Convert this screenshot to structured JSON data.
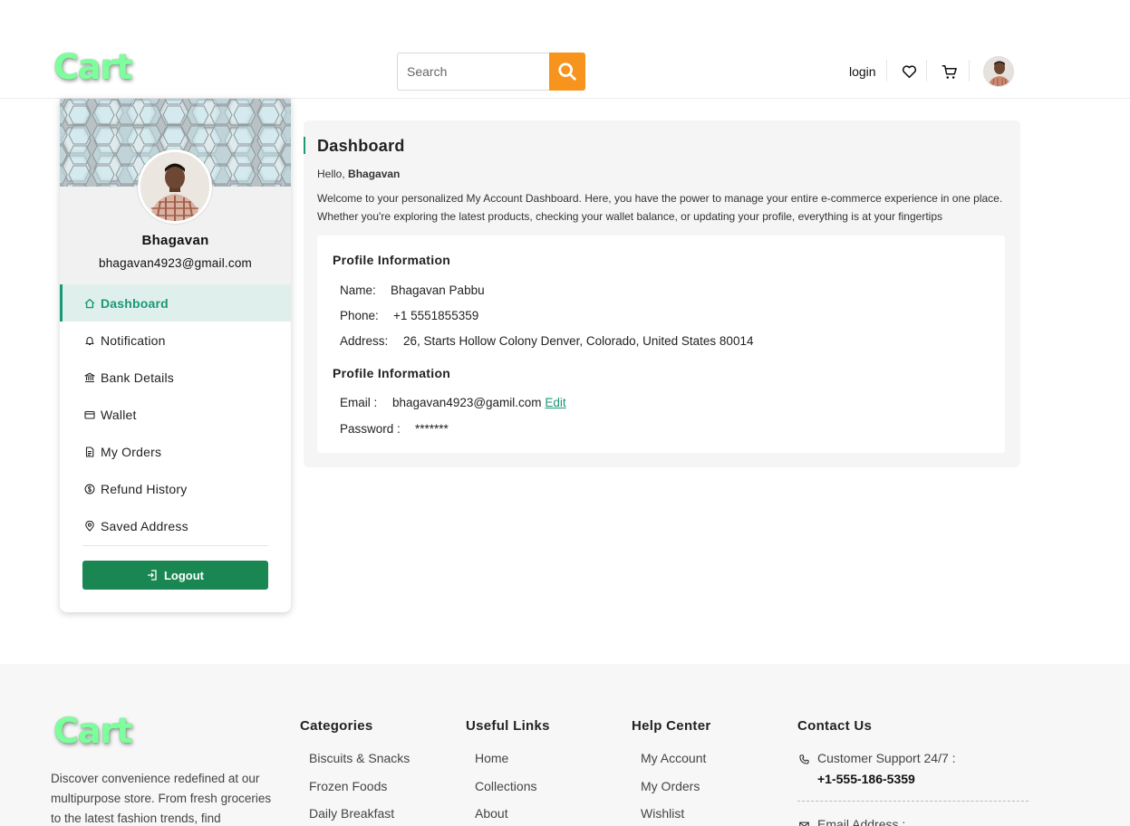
{
  "header": {
    "logo": "Cart",
    "search": {
      "placeholder": "Search",
      "value": ""
    },
    "login_label": "login",
    "icons": [
      "search-icon",
      "heart-icon",
      "cart-icon",
      "avatar"
    ]
  },
  "sidebar": {
    "name": "Bhagavan",
    "email": "bhagavan4923@gmail.com",
    "items": [
      {
        "label": "Dashboard",
        "icon": "home-icon",
        "active": true
      },
      {
        "label": "Notification",
        "icon": "bell-icon",
        "active": false
      },
      {
        "label": "Bank Details",
        "icon": "bank-icon",
        "active": false
      },
      {
        "label": "Wallet",
        "icon": "wallet-icon",
        "active": false
      },
      {
        "label": "My Orders",
        "icon": "orders-icon",
        "active": false
      },
      {
        "label": "Refund History",
        "icon": "refund-icon",
        "active": false
      },
      {
        "label": "Saved Address",
        "icon": "location-icon",
        "active": false
      }
    ],
    "logout_label": "Logout"
  },
  "dashboard": {
    "title": "Dashboard",
    "hello_prefix": "Hello,",
    "hello_name": "Bhagavan",
    "welcome": "Welcome to your personalized My Account Dashboard. Here, you have the power to manage your entire e-commerce experience in one place. Whether you're exploring the latest products, checking your wallet balance, or updating your profile, everything is at your fingertips",
    "profile_heading": "Profile Information",
    "name_label": "Name:",
    "name_value": "Bhagavan Pabbu",
    "phone_label": "Phone:",
    "phone_value": "+1 5551855359",
    "address_label": "Address:",
    "address_value": "26, Starts Hollow Colony Denver, Colorado, United States 80014",
    "account_heading": "Profile Information",
    "email_label": "Email :",
    "email_value": "bhagavan4923@gamil.com",
    "edit_label": "Edit",
    "password_label": "Password :",
    "password_value": "*******"
  },
  "footer": {
    "logo": "Cart",
    "description": "Discover convenience redefined at our multipurpose store. From fresh groceries to the latest fashion trends, find",
    "categories": {
      "title": "Categories",
      "links": [
        "Biscuits & Snacks",
        "Frozen Foods",
        "Daily Breakfast"
      ]
    },
    "useful_links": {
      "title": "Useful Links",
      "links": [
        "Home",
        "Collections",
        "About"
      ]
    },
    "help_center": {
      "title": "Help Center",
      "links": [
        "My Account",
        "My Orders",
        "Wishlist"
      ]
    },
    "contact": {
      "title": "Contact Us",
      "support_label": "Customer Support 24/7 :",
      "support_phone": "+1-555-186-5359",
      "email_label": "Email Address :"
    }
  },
  "colors": {
    "accent": "#1a9877",
    "search_button": "#f7941d",
    "logout_button": "#1a8753",
    "logo": "#7dff9c"
  }
}
